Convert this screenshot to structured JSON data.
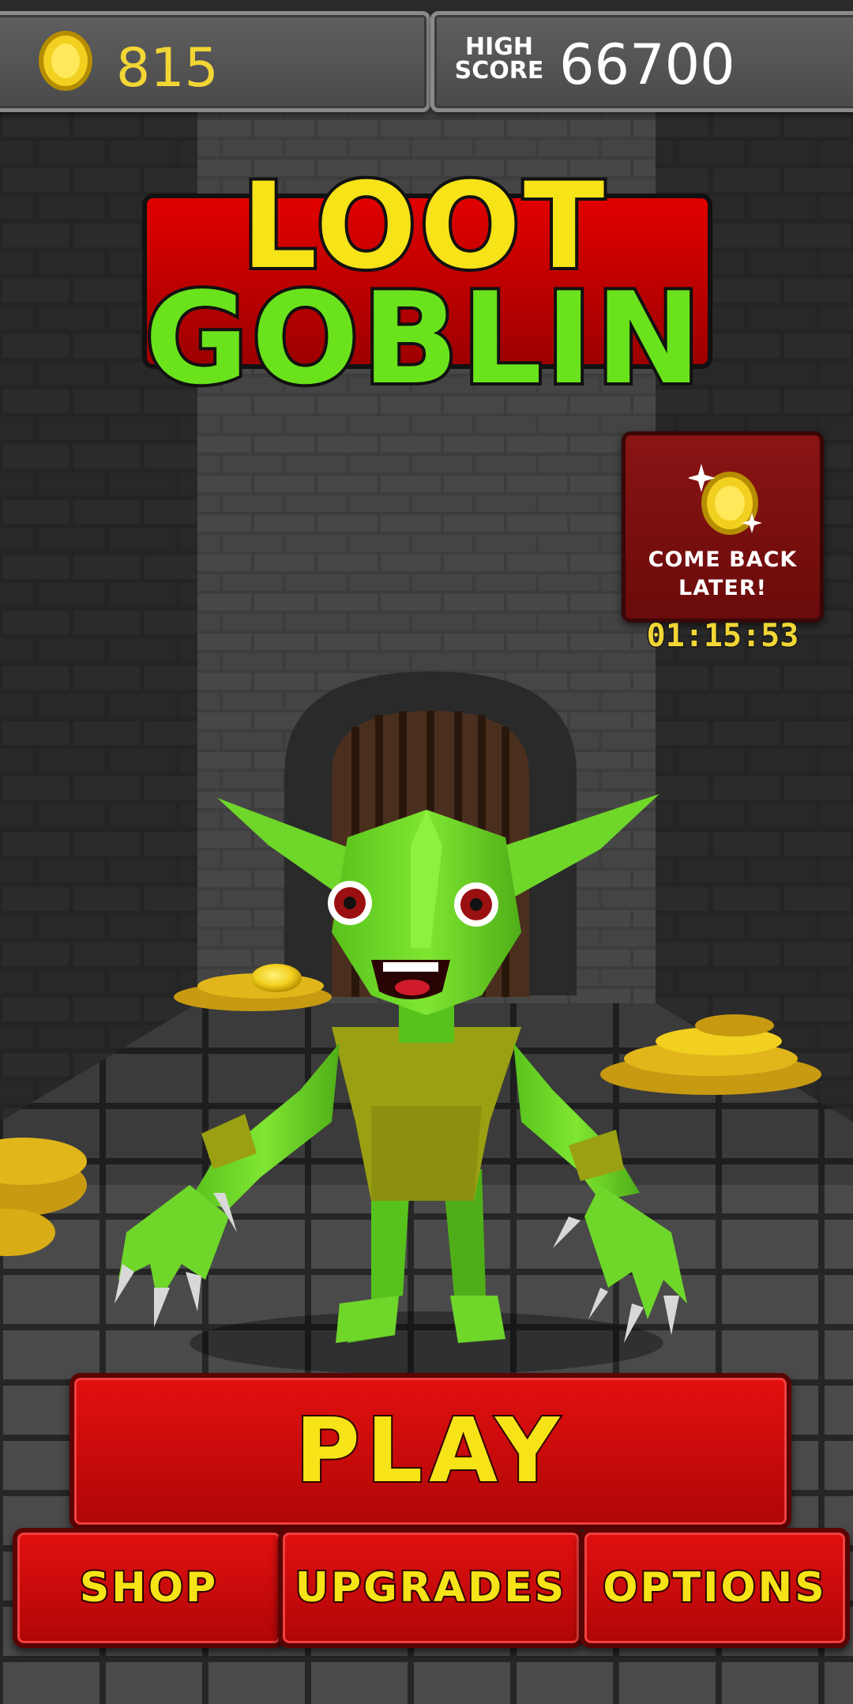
{
  "hud": {
    "coins": "815",
    "high_score_label_line1": "HIGH",
    "high_score_label_line2": "SCORE",
    "high_score": "66700"
  },
  "logo": {
    "line1": "LOOT",
    "line2": "GOBLIN"
  },
  "bonus": {
    "message_line1": "COME BACK",
    "message_line2": "LATER!",
    "timer": "01:15:53",
    "icon": "sparkling-coin-icon"
  },
  "buttons": {
    "play": "PLAY",
    "shop": "SHOP",
    "upgrades": "UPGRADES",
    "options": "OPTIONS"
  },
  "colors": {
    "coin_yellow": "#f2d635",
    "button_red": "#d00b0b",
    "logo_green": "#6be31c",
    "logo_yellow": "#f6e318"
  }
}
